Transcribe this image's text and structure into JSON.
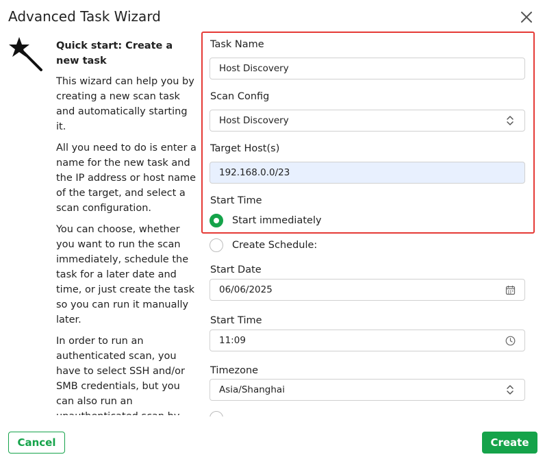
{
  "dialog": {
    "title": "Advanced Task Wizard"
  },
  "help": {
    "heading": "Quick start: Create a new task",
    "paragraphs": [
      "This wizard can help you by creating a new scan task and automatically starting it.",
      "All you need to do is enter a name for the new task and the IP address or host name of the target, and select a scan configuration.",
      "You can choose, whether you want to run the scan immediately, schedule the task for a later date and time, or just create the task so you can run it manually later.",
      "In order to run an authenticated scan, you have to select SSH and/or SMB credentials, but you can also run an unauthenticated scan by not selecting any credentials."
    ]
  },
  "form": {
    "task_name_label": "Task Name",
    "task_name_value": "Host Discovery",
    "scan_config_label": "Scan Config",
    "scan_config_value": "Host Discovery",
    "target_hosts_label": "Target Host(s)",
    "target_hosts_value": "192.168.0.0/23",
    "start_time_section_label": "Start Time",
    "start_immediately_label": "Start immediately",
    "create_schedule_label": "Create Schedule:",
    "start_date_label": "Start Date",
    "start_date_value": "06/06/2025",
    "start_time_label": "Start Time",
    "start_time_value": "11:09",
    "timezone_label": "Timezone",
    "timezone_value": "Asia/Shanghai"
  },
  "icons": {
    "close": "close-icon",
    "wand": "magic-wand-icon",
    "select": "chevron-updown-icon",
    "calendar": "calendar-icon",
    "clock": "clock-icon"
  },
  "buttons": {
    "cancel_label": "Cancel",
    "create_label": "Create"
  },
  "colors": {
    "accent": "#15a34a",
    "highlight_border": "#e53935",
    "autofill_bg": "#e8f0fe"
  }
}
